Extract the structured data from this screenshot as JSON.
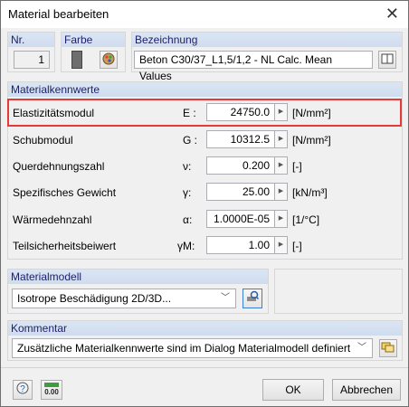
{
  "window": {
    "title": "Material bearbeiten"
  },
  "nr": {
    "label": "Nr.",
    "value": "1"
  },
  "farbe": {
    "label": "Farbe"
  },
  "bezeichnung": {
    "label": "Bezeichnung",
    "value": "Beton C30/37_L1,5/1,2 - NL Calc. Mean Values"
  },
  "materialkennwerte": {
    "label": "Materialkennwerte",
    "rows": [
      {
        "label": "Elastizitätsmodul",
        "symbol": "E :",
        "value": "24750.0",
        "unit": "[N/mm²]",
        "highlighted": true
      },
      {
        "label": "Schubmodul",
        "symbol": "G :",
        "value": "10312.5",
        "unit": "[N/mm²]"
      },
      {
        "label": "Querdehnungszahl",
        "symbol": "ν:",
        "value": "0.200",
        "unit": "[-]"
      },
      {
        "label": "Spezifisches Gewicht",
        "symbol": "γ:",
        "value": "25.00",
        "unit": "[kN/m³]"
      },
      {
        "label": "Wärmedehnzahl",
        "symbol": "α:",
        "value": "1.0000E-05",
        "unit": "[1/°C]"
      },
      {
        "label": "Teilsicherheitsbeiwert",
        "symbol": "γM:",
        "value": "1.00",
        "unit": "[-]"
      }
    ],
    "highlight_color": "#e53a3a"
  },
  "materialmodell": {
    "label": "Materialmodell",
    "value": "Isotrope Beschädigung 2D/3D..."
  },
  "kommentar": {
    "label": "Kommentar",
    "value": "Zusätzliche Materialkennwerte sind im Dialog Materialmodell definiert"
  },
  "footer": {
    "ok_label": "OK",
    "cancel_label": "Abbrechen",
    "units_icon_text": "0.00"
  }
}
